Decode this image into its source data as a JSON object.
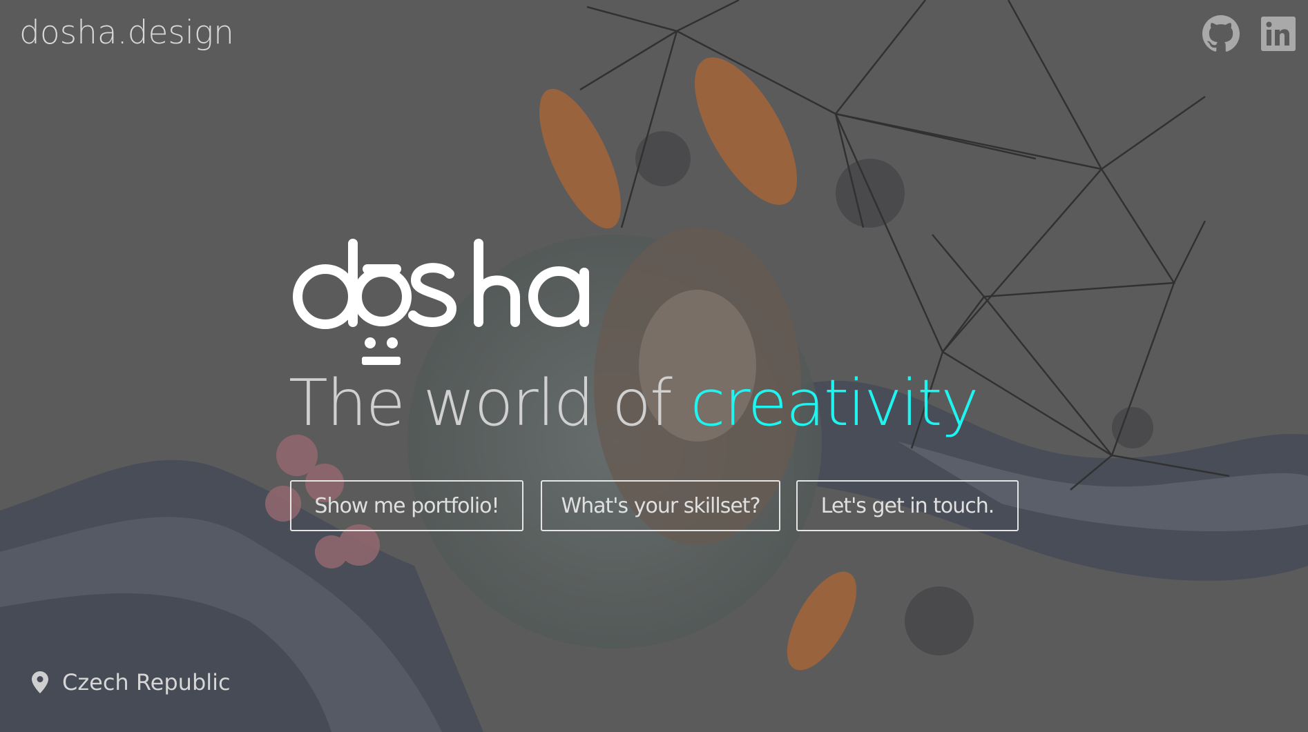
{
  "header": {
    "site_title": "dosha.design",
    "github_icon": "github-icon",
    "linkedin_icon": "linkedin-icon"
  },
  "hero": {
    "logo_text": "dōsha",
    "headline_prefix": "The world of ",
    "headline_accent": "creativity",
    "accent_color": "#1ff5f0"
  },
  "buttons": [
    {
      "label": "Show me portfolio!"
    },
    {
      "label": "What's your skillset?"
    },
    {
      "label": "Let's get in touch."
    }
  ],
  "footer": {
    "location": "Czech Republic",
    "location_icon": "map-pin-icon"
  }
}
